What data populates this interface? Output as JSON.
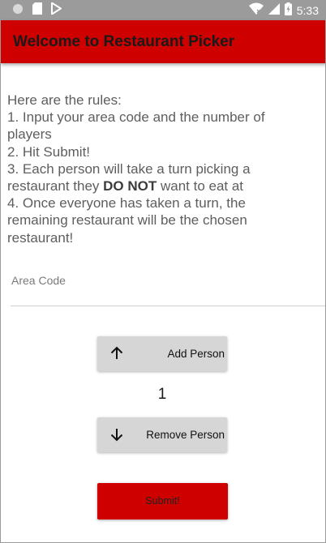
{
  "status_bar": {
    "time": "5:33",
    "left_icons": [
      "circle-notification-icon",
      "sd-card-icon",
      "play-store-icon"
    ],
    "right_icons": [
      "wifi-icon",
      "signal-icon",
      "battery-charging-icon"
    ]
  },
  "app_bar": {
    "title": "Welcome to Restaurant Picker",
    "color": "#cf0000"
  },
  "rules": {
    "intro": "Here are the rules:",
    "line1": "1. Input your area code and the number of",
    "line1b": "players",
    "line2": "2. Hit Submit!",
    "line3": "3. Each person will take a turn picking a",
    "line3b_prefix": "restaurant they ",
    "line3b_bold": "DO NOT",
    "line3b_suffix": " want to eat at",
    "line4": "4. Once everyone has taken a turn, the",
    "line4b": "remaining restaurant will be the chosen",
    "line4c": "restaurant!"
  },
  "area_code": {
    "placeholder": "Area Code",
    "value": ""
  },
  "buttons": {
    "add_label": "Add Person",
    "add_icon": "arrow-up-icon",
    "remove_label": "Remove Person",
    "remove_icon": "arrow-down-icon",
    "submit_label": "Submit!",
    "gray_color": "#d6d6d6",
    "submit_color": "#cf0000"
  },
  "person_count": "1"
}
